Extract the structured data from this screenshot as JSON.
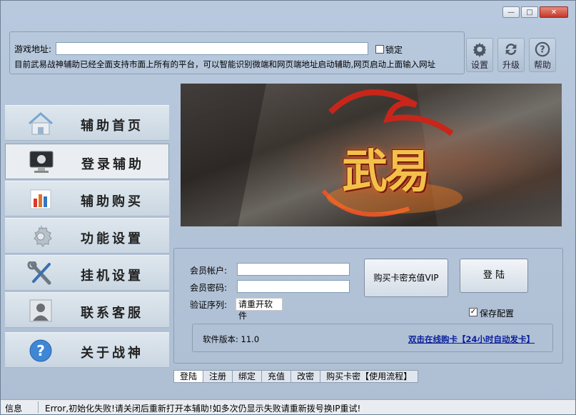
{
  "window": {
    "minimize": "—",
    "maximize": "□",
    "close": "✕"
  },
  "address": {
    "label": "游戏地址:",
    "value": "",
    "lock_label": "锁定",
    "info": "目前武易战神辅助已经全面支持市面上所有的平台，可以智能识别微端和网页端地址启动辅助,网页启动上面输入网址"
  },
  "toolbar": [
    {
      "label": "设置",
      "icon": "gear-icon"
    },
    {
      "label": "升级",
      "icon": "recycle-icon"
    },
    {
      "label": "帮助",
      "icon": "help-icon"
    }
  ],
  "nav": [
    {
      "label": "辅助首页",
      "icon": "home-icon"
    },
    {
      "label": "登录辅助",
      "icon": "monitor-icon",
      "active": true
    },
    {
      "label": "辅助购买",
      "icon": "bar-chart-icon"
    },
    {
      "label": "功能设置",
      "icon": "gear-icon"
    },
    {
      "label": "挂机设置",
      "icon": "wrench-icon"
    },
    {
      "label": "联系客服",
      "icon": "contact-icon"
    },
    {
      "label": "关于战神",
      "icon": "question-icon"
    }
  ],
  "banner": {
    "logo_text": "武易"
  },
  "login": {
    "account_label": "会员帐户:",
    "account_value": "",
    "password_label": "会员密码:",
    "password_value": "",
    "captcha_label": "验证序列:",
    "captcha_value": "请重开软件",
    "buy_vip_button": "购买卡密充值VIP",
    "login_button": "登 陆",
    "save_config_label": "保存配置",
    "save_config_checked": true,
    "version_text": "软件版本: 11.0",
    "buy_link": "双击在线购卡【24小时自动发卡】"
  },
  "tabs": [
    {
      "label": "登陆",
      "active": true
    },
    {
      "label": "注册"
    },
    {
      "label": "绑定"
    },
    {
      "label": "充值"
    },
    {
      "label": "改密"
    },
    {
      "label": "购买卡密【使用流程】"
    }
  ],
  "status": {
    "label": "信息",
    "message": "Error,初始化失败!请关闭后重新打开本辅助!如多次仍显示失败请重新拨号换IP重试!"
  },
  "colors": {
    "link": "#0a1f9c",
    "window_bg": "#b3c3d8",
    "logo_gold": "#f2c14a",
    "logo_red": "#c8261a"
  }
}
